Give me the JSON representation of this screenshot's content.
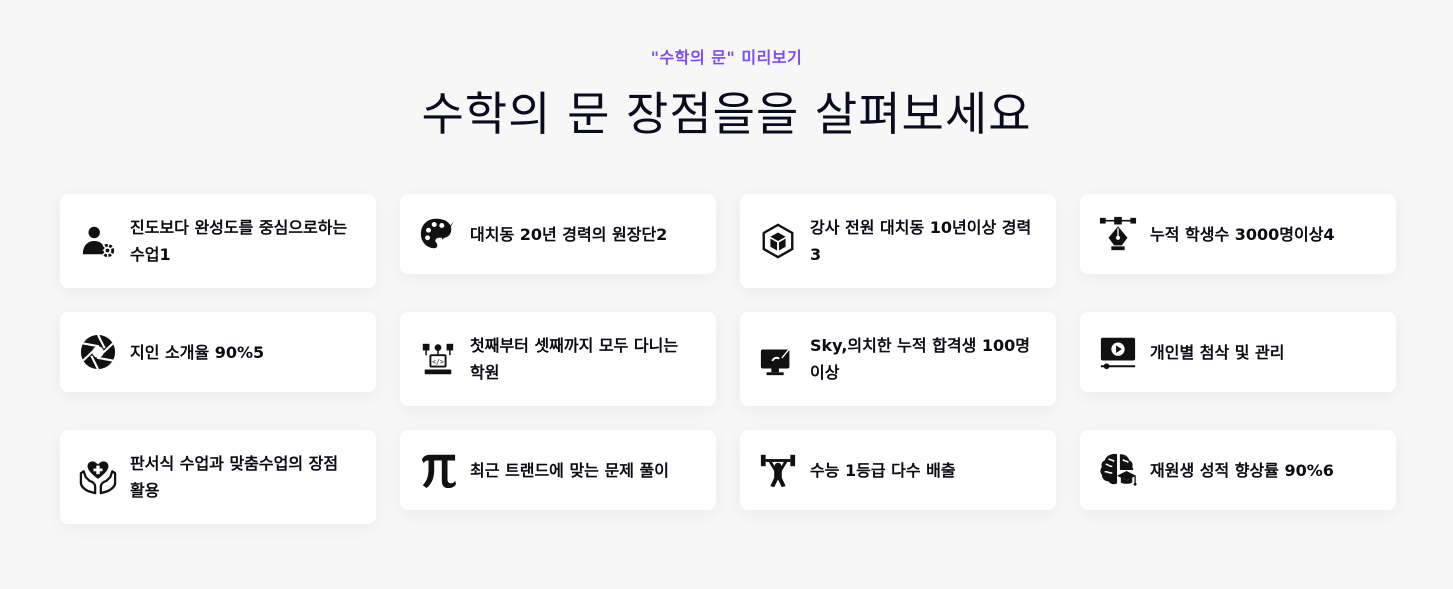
{
  "section": {
    "eyebrow": "\"수학의 문\" 미리보기",
    "title": "수학의 문 장점을을 살펴보세요"
  },
  "cards": [
    {
      "icon": "user-gear-icon",
      "label": "진도보다 완성도를 중심으로하는 수업1"
    },
    {
      "icon": "palette-brush-icon",
      "label": "대치동 20년 경력의 원장단2"
    },
    {
      "icon": "cube-hexagon-icon",
      "label": "강사 전원 대치동 10년이상 경력3"
    },
    {
      "icon": "pen-nib-bezier-icon",
      "label": "누적 학생수 3000명이상4"
    },
    {
      "icon": "camera-aperture-icon",
      "label": "지인 소개율 90%5"
    },
    {
      "icon": "developer-network-icon",
      "label": "첫째부터 셋째까지 모두 다니는 학원"
    },
    {
      "icon": "monitor-brush-icon",
      "label": "Sky,의치한 누적 합격생 100명 이상"
    },
    {
      "icon": "video-player-icon",
      "label": "개인별 첨삭 및 관리"
    },
    {
      "icon": "hands-heart-icon",
      "label": "판서식 수업과 맞춤수업의 장점 활용"
    },
    {
      "icon": "pi-symbol-icon",
      "label": "최근 트랜드에 맞는 문제 풀이"
    },
    {
      "icon": "weightlifter-icon",
      "label": "수능 1등급 다수 배출"
    },
    {
      "icon": "brain-graduate-icon",
      "label": "재원생 성적 향상률 90%6"
    }
  ]
}
